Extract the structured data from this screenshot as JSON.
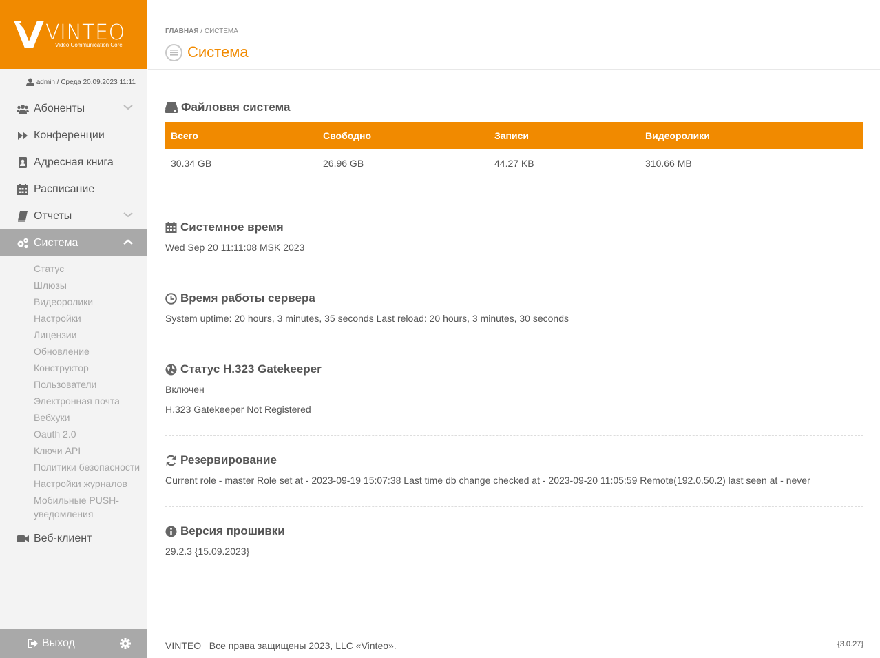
{
  "brand": {
    "name": "VINTEO",
    "tagline": "Video Communication Core",
    "color": "#f18a00"
  },
  "user_line": "admin / Среда 20.09.2023 11:11",
  "nav": {
    "abonenty": "Абоненты",
    "konferencii": "Конференции",
    "adresnaya": "Адресная книга",
    "raspisanie": "Расписание",
    "otchety": "Отчеты",
    "sistema": "Система",
    "veb_klient": "Веб-клиент"
  },
  "submenu": [
    "Статус",
    "Шлюзы",
    "Видеоролики",
    "Настройки",
    "Лицензии",
    "Обновление",
    "Конструктор",
    "Пользователи",
    "Электронная почта",
    "Вебхуки",
    "Oauth 2.0",
    "Ключи API",
    "Политики безопасности",
    "Настройки журналов",
    "Мобильные PUSH-",
    "уведомления"
  ],
  "logout": "Выход",
  "breadcrumb": {
    "home": "Главная",
    "sep": "/",
    "current": "Система"
  },
  "page_title": "Система",
  "filesystem": {
    "title": "Файловая система",
    "headers": [
      "Всего",
      "Свободно",
      "Записи",
      "Видеоролики"
    ],
    "values": [
      "30.34 GB",
      "26.96 GB",
      "44.27 KB",
      "310.66 MB"
    ]
  },
  "system_time": {
    "title": "Системное время",
    "value": "Wed Sep 20 11:11:08 MSK 2023"
  },
  "uptime": {
    "title": "Время работы сервера",
    "value": "System uptime: 20 hours, 3 minutes, 35 seconds Last reload: 20 hours, 3 minutes, 30 seconds"
  },
  "gatekeeper": {
    "title": "Статус H.323 Gatekeeper",
    "state": "Включен",
    "status": "H.323 Gatekeeper Not Registered"
  },
  "backup": {
    "title": "Резервирование",
    "value": "Current role - master Role set at - 2023-09-19 15:07:38 Last time db change checked at - 2023-09-20 11:05:59 Remote(192.0.50.2) last seen at - never"
  },
  "firmware": {
    "title": "Версия прошивки",
    "value": "29.2.3 {15.09.2023}"
  },
  "footer": {
    "copyright": "VINTEO   Все права защищены 2023, LLC «Vinteo».",
    "version": "{3.0.27}"
  }
}
